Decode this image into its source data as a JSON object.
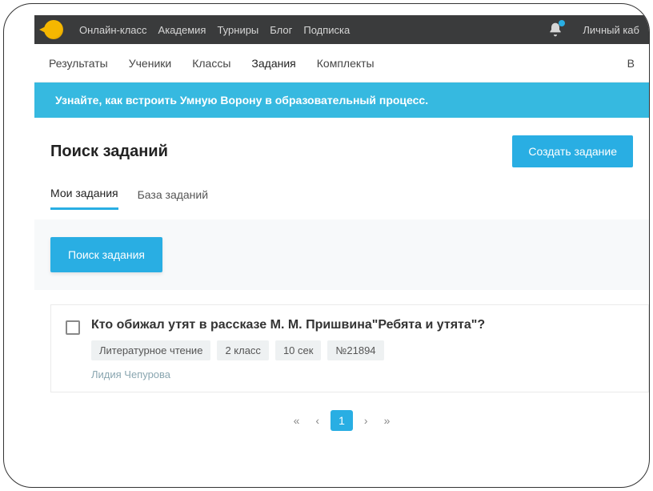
{
  "colors": {
    "accent": "#29aee3",
    "darknav": "#3a3b3c"
  },
  "topnav": {
    "items": [
      {
        "label": "Онлайн-класс"
      },
      {
        "label": "Академия"
      },
      {
        "label": "Турниры"
      },
      {
        "label": "Блог"
      },
      {
        "label": "Подписка"
      }
    ],
    "account_label": "Личный каб"
  },
  "subtabs": {
    "items": [
      {
        "label": "Результаты"
      },
      {
        "label": "Ученики"
      },
      {
        "label": "Классы"
      },
      {
        "label": "Задания",
        "active": true
      },
      {
        "label": "Комплекты"
      }
    ],
    "right_label": "В"
  },
  "banner": {
    "text": "Узнайте, как встроить Умную Ворону в образовательный процесс."
  },
  "page": {
    "title": "Поиск заданий",
    "create_button": "Создать задание"
  },
  "innertabs": {
    "items": [
      {
        "label": "Мои задания",
        "active": true
      },
      {
        "label": "База заданий"
      }
    ]
  },
  "search": {
    "button_label": "Поиск задания"
  },
  "task": {
    "title": "Кто обижал утят в рассказе М. М. Пришвина\"Ребята и утята\"?",
    "tags": [
      "Литературное чтение",
      "2 класс",
      "10 сек",
      "№21894"
    ],
    "author": "Лидия Чепурова"
  },
  "pagination": {
    "first": "«",
    "prev": "‹",
    "current": "1",
    "next": "›",
    "last": "»"
  }
}
